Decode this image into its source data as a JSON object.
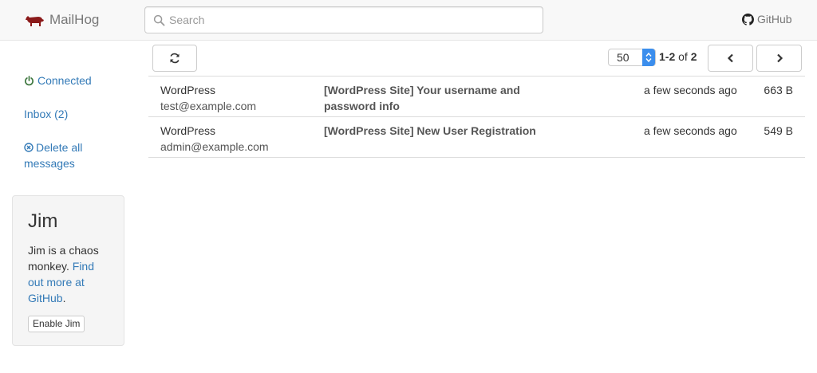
{
  "navbar": {
    "brand": "MailHog",
    "search_placeholder": "Search",
    "github_label": "GitHub"
  },
  "sidebar": {
    "status": "Connected",
    "inbox": "Inbox (2)",
    "delete_all": "Delete all messages"
  },
  "jim": {
    "title": "Jim",
    "desc_prefix": "Jim is a chaos monkey.",
    "link_text": "Find out more at GitHub",
    "desc_suffix": ".",
    "button_label": "Enable Jim"
  },
  "toolbar": {
    "per_page": "50",
    "range": "1-2",
    "of_label": "of",
    "total": "2"
  },
  "messages": [
    {
      "from_name": "WordPress",
      "from_email": "test@example.com",
      "subject": "[WordPress Site] Your username and password info",
      "time": "a few seconds ago",
      "size": "663 B"
    },
    {
      "from_name": "WordPress",
      "from_email": "admin@example.com",
      "subject": "[WordPress Site] New User Registration",
      "time": "a few seconds ago",
      "size": "549 B"
    }
  ],
  "colors": {
    "link": "#337ab7",
    "connected": "#3c763d",
    "stepper": "#3b8eed",
    "logo": "#8b1a1a"
  },
  "icons": {
    "logo": "pig-logo-icon",
    "search": "search-icon",
    "github": "github-icon",
    "connected": "power-icon",
    "delete": "circle-x-icon",
    "refresh": "refresh-icon",
    "stepper": "stepper-icon",
    "prev": "chevron-left-icon",
    "next": "chevron-right-icon"
  }
}
